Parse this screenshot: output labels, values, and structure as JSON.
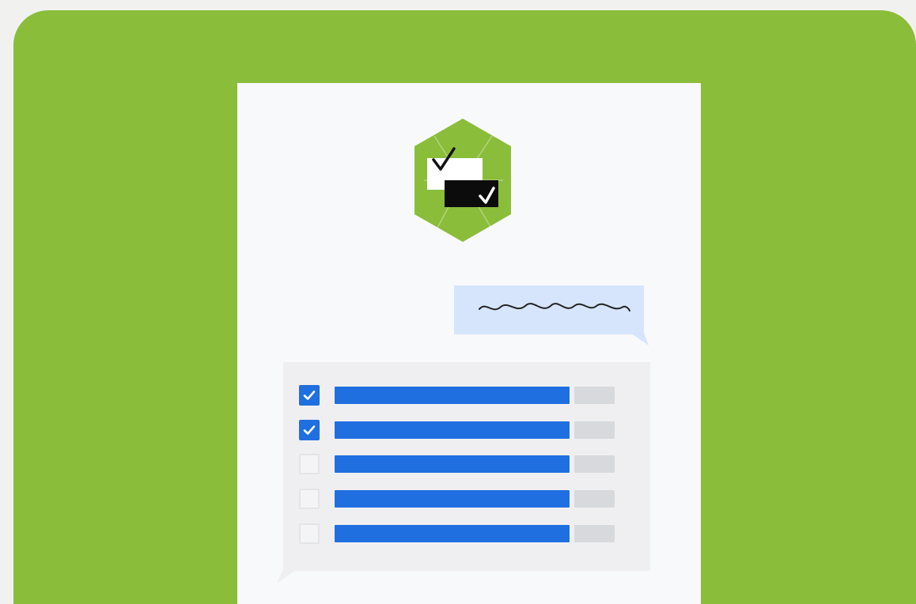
{
  "colors": {
    "page_background": "#f1f2f0",
    "panel_green": "#8abd3a",
    "document": "#f8f9fb",
    "badge_green": "#8abd3a",
    "speech_bubble": "#d6e5fb",
    "list_card": "#efeff1",
    "bar_blue": "#1f6fe0",
    "bar_gray": "#d8d9dc",
    "checkbox_border": "#e3e4e7"
  },
  "icons": {
    "badge": "hexagon-checklist-badge-icon",
    "scribble": "handwritten-scribble-icon",
    "check": "checkmark-icon"
  },
  "checklist": {
    "items": [
      {
        "checked": true,
        "fill_fraction": 1.0
      },
      {
        "checked": true,
        "fill_fraction": 1.0
      },
      {
        "checked": false,
        "fill_fraction": 1.0
      },
      {
        "checked": false,
        "fill_fraction": 1.0
      },
      {
        "checked": false,
        "fill_fraction": 1.0
      }
    ]
  }
}
